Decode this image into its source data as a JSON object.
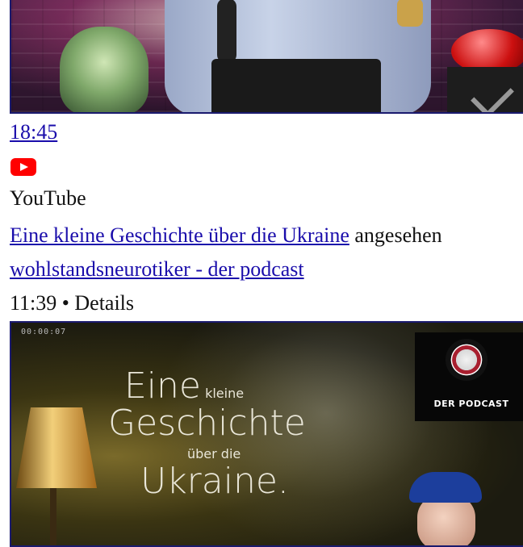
{
  "video1": {
    "duration": "18:45"
  },
  "source": {
    "icon": "youtube-icon",
    "name": "YouTube"
  },
  "history_item": {
    "title_link": "Eine kleine Geschichte über die Ukraine",
    "action_text": "angesehen",
    "channel_link": "wohlstandsneurotiker - der podcast",
    "time": "11:39",
    "separator": "•",
    "details_label": "Details"
  },
  "video2_thumbnail": {
    "timecode": "00:00:07",
    "title_lines": [
      "Eine",
      "kleine",
      "Geschichte",
      "über die",
      "Ukraine."
    ],
    "badge_text": "DER PODCAST"
  },
  "colors": {
    "link": "#1a0dab",
    "youtube_red": "#ff0000",
    "thumbnail_border": "#1a1a6e"
  }
}
